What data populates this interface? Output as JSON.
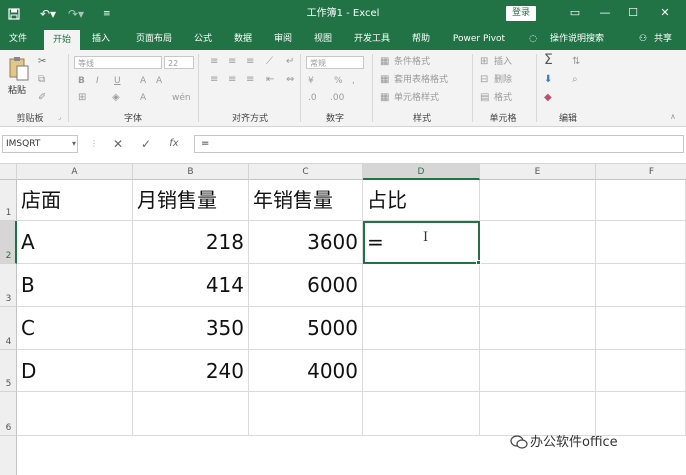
{
  "window": {
    "title": "工作簿1 - Excel",
    "login_label": "登录",
    "controls": [
      "▭",
      "—",
      "☐",
      "✕"
    ]
  },
  "quick_access": {
    "save_icon": "save-icon",
    "undo_icon": "undo-icon",
    "redo_icon": "redo-icon",
    "customize_icon": "customize-icon"
  },
  "tabs": [
    {
      "label": "文件"
    },
    {
      "label": "开始"
    },
    {
      "label": "插入"
    },
    {
      "label": "页面布局"
    },
    {
      "label": "公式"
    },
    {
      "label": "数据"
    },
    {
      "label": "审阅"
    },
    {
      "label": "视图"
    },
    {
      "label": "开发工具"
    },
    {
      "label": "帮助"
    },
    {
      "label": "Power Pivot"
    },
    {
      "label": "操作说明搜索"
    },
    {
      "label": "共享"
    }
  ],
  "ribbon": {
    "clipboard": {
      "label": "剪贴板",
      "paste_label": "粘贴"
    },
    "font": {
      "label": "字体",
      "font_name": "等线",
      "font_size": "22"
    },
    "alignment": {
      "label": "对齐方式"
    },
    "number": {
      "label": "数字",
      "format": "常规"
    },
    "styles": {
      "label": "样式",
      "conditional": "条件格式",
      "table": "套用表格格式",
      "cell_styles": "单元格样式"
    },
    "cells": {
      "label": "单元格",
      "insert": "插入",
      "delete": "删除",
      "format": "格式"
    },
    "editing": {
      "label": "编辑"
    }
  },
  "formula_bar": {
    "name_box": "IMSQRT",
    "cancel": "✕",
    "enter": "✓",
    "fx": "fx",
    "content": "="
  },
  "columns": [
    "A",
    "B",
    "C",
    "D",
    "E",
    "F"
  ],
  "rows": [
    "1",
    "2",
    "3",
    "4",
    "5",
    "6"
  ],
  "cells": {
    "A1": "店面",
    "B1": "月销售量",
    "C1": "年销售量",
    "D1": "占比",
    "A2": "A",
    "B2": "218",
    "C2": "3600",
    "D2": "=",
    "A3": "B",
    "B3": "414",
    "C3": "6000",
    "A4": "C",
    "B4": "350",
    "C4": "5000",
    "A5": "D",
    "B5": "240",
    "C5": "4000"
  },
  "cursor_glyph": "I",
  "watermark": "办公软件office"
}
